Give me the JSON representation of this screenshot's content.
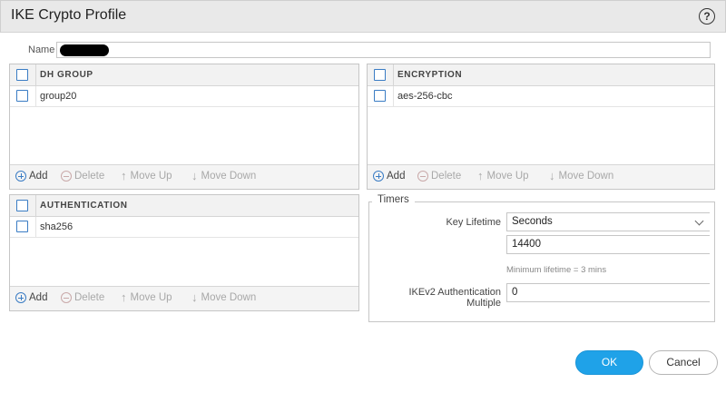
{
  "dialog": {
    "title": "IKE Crypto Profile",
    "help_glyph": "?"
  },
  "name_field": {
    "label": "Name",
    "value": ""
  },
  "dh_group": {
    "header": "DH GROUP",
    "rows": [
      "group20"
    ]
  },
  "encryption": {
    "header": "ENCRYPTION",
    "rows": [
      "aes-256-cbc"
    ]
  },
  "authentication": {
    "header": "AUTHENTICATION",
    "rows": [
      "sha256"
    ]
  },
  "toolbar": {
    "add": "Add",
    "delete": "Delete",
    "move_up": "Move Up",
    "move_down": "Move Down"
  },
  "timers": {
    "legend": "Timers",
    "key_lifetime_label": "Key Lifetime",
    "key_lifetime_unit": "Seconds",
    "key_lifetime_value": "14400",
    "key_lifetime_hint": "Minimum lifetime = 3 mins",
    "ikev2_label_line1": "IKEv2 Authentication",
    "ikev2_label_line2": "Multiple",
    "ikev2_value": "0"
  },
  "buttons": {
    "ok": "OK",
    "cancel": "Cancel"
  },
  "colors": {
    "accent": "#1fa2e8",
    "checkbox": "#3a7cc4"
  }
}
